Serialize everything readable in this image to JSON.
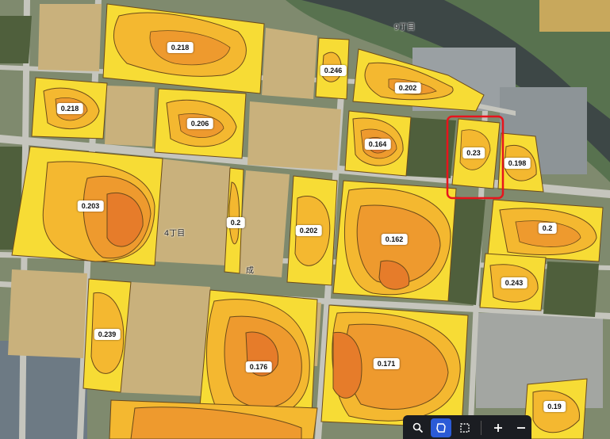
{
  "map": {
    "place_labels": [
      "9丁目",
      "4丁目",
      "成"
    ],
    "field_values": [
      "0.218",
      "0.246",
      "0.202",
      "0.218",
      "0.206",
      "0.164",
      "0.23",
      "0.198",
      "0.203",
      "0.2",
      "0.202",
      "0.162",
      "0.2",
      "0.243",
      "0.239",
      "0.176",
      "0.171",
      "0.19"
    ],
    "selected_field_value": "0.23",
    "colors": {
      "yellow": "#f7dc35",
      "light_orange": "#f4b830",
      "orange": "#ee9a2e",
      "dark_orange": "#e67c2a",
      "selection": "#e8141c"
    }
  },
  "toolbar": {
    "icons": [
      "search-icon",
      "lasso-icon",
      "rectangle-select-icon",
      "zoom-in-icon",
      "zoom-out-icon"
    ],
    "active_tool": "lasso-icon"
  }
}
